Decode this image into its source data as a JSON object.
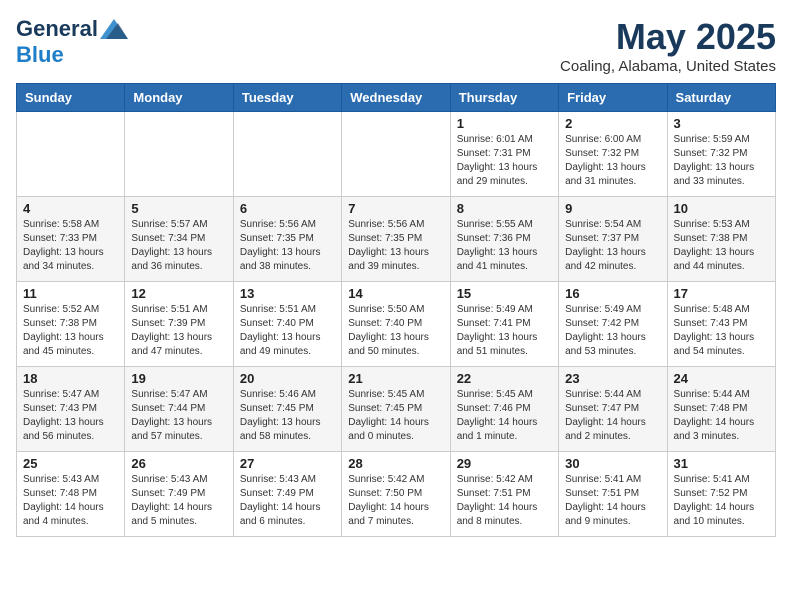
{
  "header": {
    "logo_general": "General",
    "logo_blue": "Blue",
    "title": "May 2025",
    "subtitle": "Coaling, Alabama, United States"
  },
  "weekdays": [
    "Sunday",
    "Monday",
    "Tuesday",
    "Wednesday",
    "Thursday",
    "Friday",
    "Saturday"
  ],
  "weeks": [
    [
      {
        "day": "",
        "info": ""
      },
      {
        "day": "",
        "info": ""
      },
      {
        "day": "",
        "info": ""
      },
      {
        "day": "",
        "info": ""
      },
      {
        "day": "1",
        "info": "Sunrise: 6:01 AM\nSunset: 7:31 PM\nDaylight: 13 hours\nand 29 minutes."
      },
      {
        "day": "2",
        "info": "Sunrise: 6:00 AM\nSunset: 7:32 PM\nDaylight: 13 hours\nand 31 minutes."
      },
      {
        "day": "3",
        "info": "Sunrise: 5:59 AM\nSunset: 7:32 PM\nDaylight: 13 hours\nand 33 minutes."
      }
    ],
    [
      {
        "day": "4",
        "info": "Sunrise: 5:58 AM\nSunset: 7:33 PM\nDaylight: 13 hours\nand 34 minutes."
      },
      {
        "day": "5",
        "info": "Sunrise: 5:57 AM\nSunset: 7:34 PM\nDaylight: 13 hours\nand 36 minutes."
      },
      {
        "day": "6",
        "info": "Sunrise: 5:56 AM\nSunset: 7:35 PM\nDaylight: 13 hours\nand 38 minutes."
      },
      {
        "day": "7",
        "info": "Sunrise: 5:56 AM\nSunset: 7:35 PM\nDaylight: 13 hours\nand 39 minutes."
      },
      {
        "day": "8",
        "info": "Sunrise: 5:55 AM\nSunset: 7:36 PM\nDaylight: 13 hours\nand 41 minutes."
      },
      {
        "day": "9",
        "info": "Sunrise: 5:54 AM\nSunset: 7:37 PM\nDaylight: 13 hours\nand 42 minutes."
      },
      {
        "day": "10",
        "info": "Sunrise: 5:53 AM\nSunset: 7:38 PM\nDaylight: 13 hours\nand 44 minutes."
      }
    ],
    [
      {
        "day": "11",
        "info": "Sunrise: 5:52 AM\nSunset: 7:38 PM\nDaylight: 13 hours\nand 45 minutes."
      },
      {
        "day": "12",
        "info": "Sunrise: 5:51 AM\nSunset: 7:39 PM\nDaylight: 13 hours\nand 47 minutes."
      },
      {
        "day": "13",
        "info": "Sunrise: 5:51 AM\nSunset: 7:40 PM\nDaylight: 13 hours\nand 49 minutes."
      },
      {
        "day": "14",
        "info": "Sunrise: 5:50 AM\nSunset: 7:40 PM\nDaylight: 13 hours\nand 50 minutes."
      },
      {
        "day": "15",
        "info": "Sunrise: 5:49 AM\nSunset: 7:41 PM\nDaylight: 13 hours\nand 51 minutes."
      },
      {
        "day": "16",
        "info": "Sunrise: 5:49 AM\nSunset: 7:42 PM\nDaylight: 13 hours\nand 53 minutes."
      },
      {
        "day": "17",
        "info": "Sunrise: 5:48 AM\nSunset: 7:43 PM\nDaylight: 13 hours\nand 54 minutes."
      }
    ],
    [
      {
        "day": "18",
        "info": "Sunrise: 5:47 AM\nSunset: 7:43 PM\nDaylight: 13 hours\nand 56 minutes."
      },
      {
        "day": "19",
        "info": "Sunrise: 5:47 AM\nSunset: 7:44 PM\nDaylight: 13 hours\nand 57 minutes."
      },
      {
        "day": "20",
        "info": "Sunrise: 5:46 AM\nSunset: 7:45 PM\nDaylight: 13 hours\nand 58 minutes."
      },
      {
        "day": "21",
        "info": "Sunrise: 5:45 AM\nSunset: 7:45 PM\nDaylight: 14 hours\nand 0 minutes."
      },
      {
        "day": "22",
        "info": "Sunrise: 5:45 AM\nSunset: 7:46 PM\nDaylight: 14 hours\nand 1 minute."
      },
      {
        "day": "23",
        "info": "Sunrise: 5:44 AM\nSunset: 7:47 PM\nDaylight: 14 hours\nand 2 minutes."
      },
      {
        "day": "24",
        "info": "Sunrise: 5:44 AM\nSunset: 7:48 PM\nDaylight: 14 hours\nand 3 minutes."
      }
    ],
    [
      {
        "day": "25",
        "info": "Sunrise: 5:43 AM\nSunset: 7:48 PM\nDaylight: 14 hours\nand 4 minutes."
      },
      {
        "day": "26",
        "info": "Sunrise: 5:43 AM\nSunset: 7:49 PM\nDaylight: 14 hours\nand 5 minutes."
      },
      {
        "day": "27",
        "info": "Sunrise: 5:43 AM\nSunset: 7:49 PM\nDaylight: 14 hours\nand 6 minutes."
      },
      {
        "day": "28",
        "info": "Sunrise: 5:42 AM\nSunset: 7:50 PM\nDaylight: 14 hours\nand 7 minutes."
      },
      {
        "day": "29",
        "info": "Sunrise: 5:42 AM\nSunset: 7:51 PM\nDaylight: 14 hours\nand 8 minutes."
      },
      {
        "day": "30",
        "info": "Sunrise: 5:41 AM\nSunset: 7:51 PM\nDaylight: 14 hours\nand 9 minutes."
      },
      {
        "day": "31",
        "info": "Sunrise: 5:41 AM\nSunset: 7:52 PM\nDaylight: 14 hours\nand 10 minutes."
      }
    ]
  ]
}
